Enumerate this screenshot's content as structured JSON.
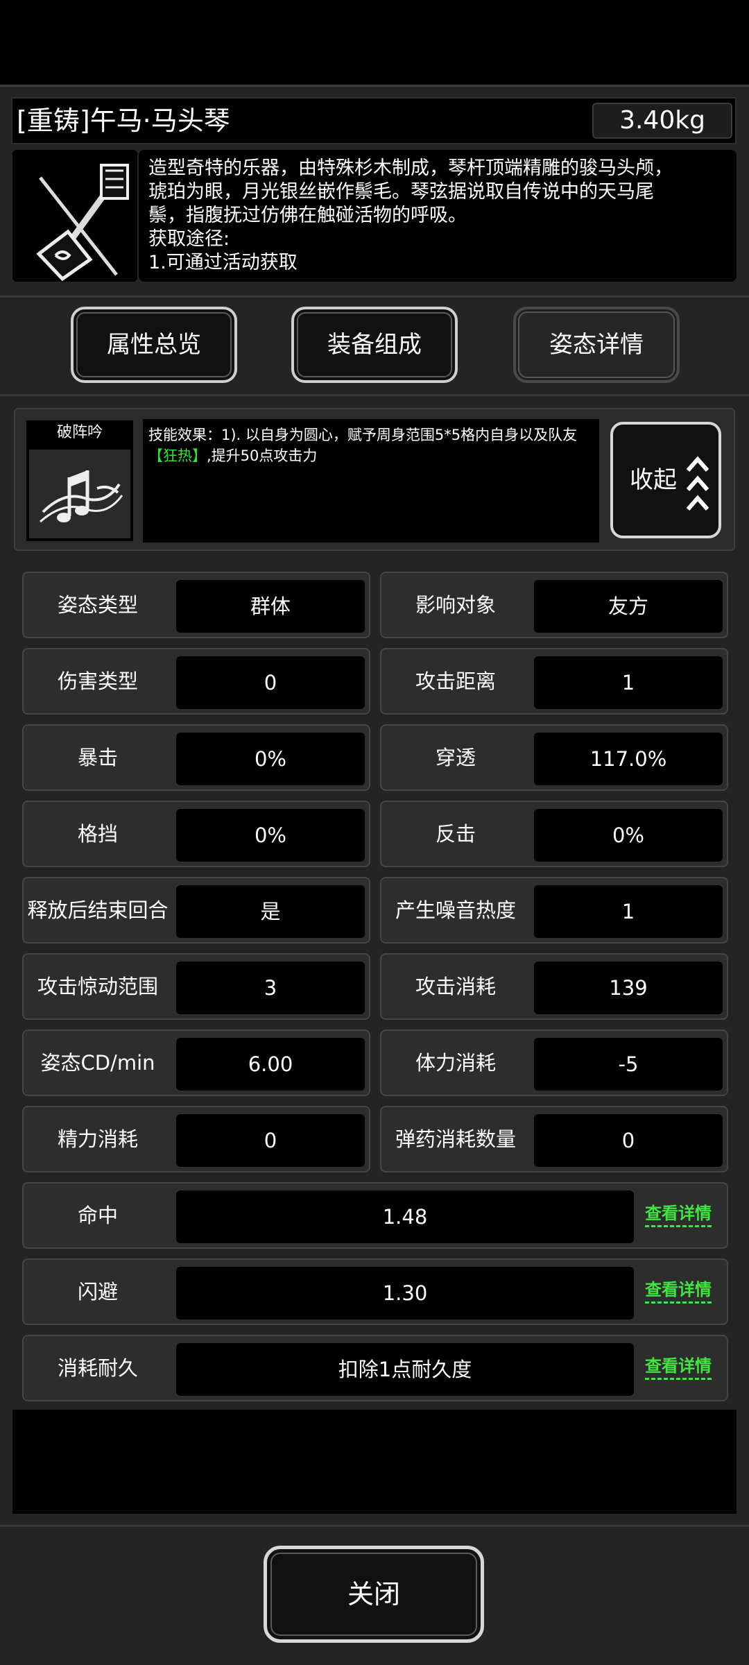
{
  "item": {
    "title": "[重铸]午马·马头琴",
    "weight": "3.40kg",
    "icon": "horsehead-fiddle-icon",
    "description_lines": [
      "造型奇特的乐器，由特殊杉木制成，琴杆顶端精雕的骏马头颅，",
      "琥珀为眼，月光银丝嵌作鬃毛。琴弦据说取自传说中的天马尾",
      "鬃，指腹抚过仿佛在触碰活物的呼吸。",
      "获取途径:",
      "1.可通过活动获取"
    ]
  },
  "tabs": [
    {
      "label": "属性总览"
    },
    {
      "label": "装备组成"
    },
    {
      "label": "姿态详情"
    }
  ],
  "skill": {
    "name": "破阵吟",
    "icon": "music-notes-icon",
    "desc_prefix": "技能效果：1). 以自身为圆心，赋予周身范围5*5格内自身以及队友",
    "desc_highlight": "【狂热】",
    "desc_suffix": ",提升50点攻击力",
    "collapse_label": "收起",
    "collapse_icon": "triple-chevron-up-icon"
  },
  "stats": [
    {
      "label": "姿态类型",
      "value": "群体"
    },
    {
      "label": "影响对象",
      "value": "友方"
    },
    {
      "label": "伤害类型",
      "value": "0"
    },
    {
      "label": "攻击距离",
      "value": "1"
    },
    {
      "label": "暴击",
      "value": "0%"
    },
    {
      "label": "穿透",
      "value": "117.0%"
    },
    {
      "label": "格挡",
      "value": "0%"
    },
    {
      "label": "反击",
      "value": "0%"
    },
    {
      "label": "释放后结束回合",
      "value": "是"
    },
    {
      "label": "产生噪音热度",
      "value": "1"
    },
    {
      "label": "攻击惊动范围",
      "value": "3"
    },
    {
      "label": "攻击消耗",
      "value": "139"
    },
    {
      "label": "姿态CD/min",
      "value": "6.00"
    },
    {
      "label": "体力消耗",
      "value": "-5"
    },
    {
      "label": "精力消耗",
      "value": "0"
    },
    {
      "label": "弹药消耗数量",
      "value": "0"
    }
  ],
  "wide_stats": [
    {
      "label": "命中",
      "value": "1.48",
      "link": "查看详情"
    },
    {
      "label": "闪避",
      "value": "1.30",
      "link": "查看详情"
    },
    {
      "label": "消耗耐久",
      "value": "扣除1点耐久度",
      "link": "查看详情"
    }
  ],
  "close_label": "关闭",
  "colors": {
    "highlight": "#2ee82e",
    "panel": "#242424",
    "border": "#d7d7d7"
  }
}
